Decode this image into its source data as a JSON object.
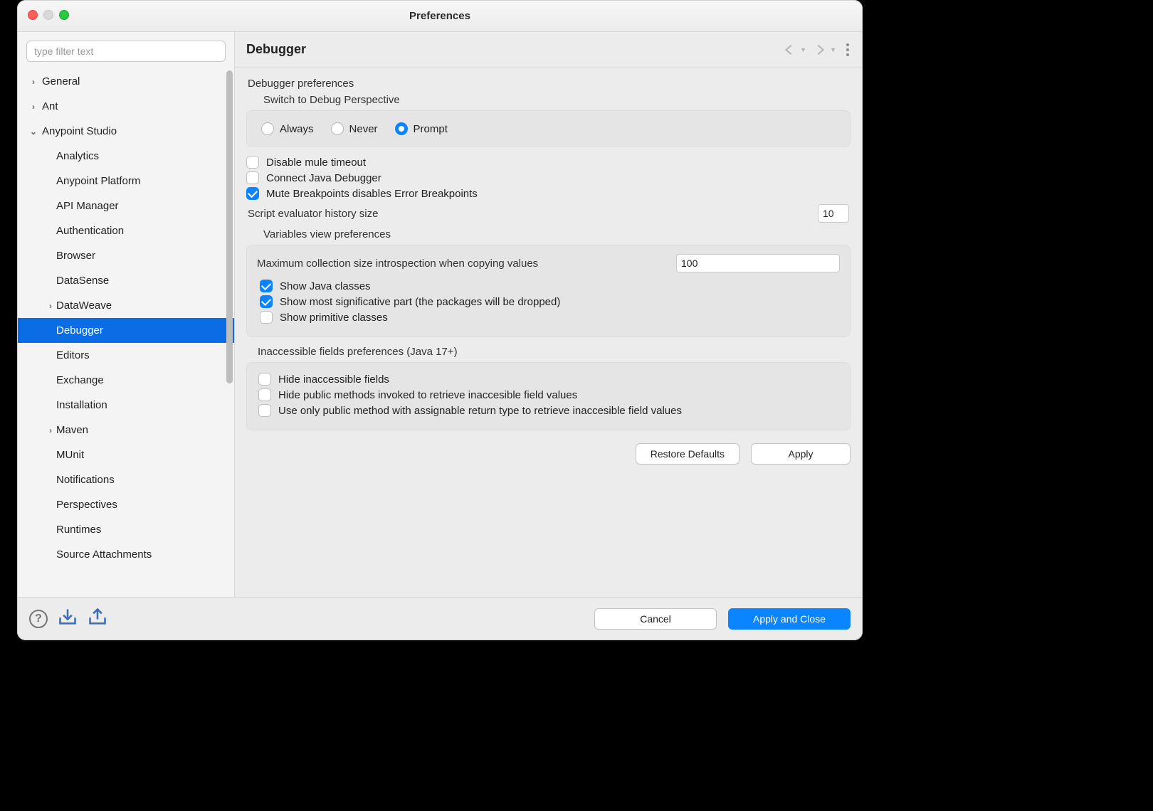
{
  "window": {
    "title": "Preferences"
  },
  "sidebar": {
    "filter_placeholder": "type filter text",
    "items": [
      {
        "label": "General",
        "level": 1,
        "arrow": "right"
      },
      {
        "label": "Ant",
        "level": 1,
        "arrow": "right"
      },
      {
        "label": "Anypoint Studio",
        "level": 1,
        "arrow": "down"
      },
      {
        "label": "Analytics",
        "level": 2
      },
      {
        "label": "Anypoint Platform",
        "level": 2
      },
      {
        "label": "API Manager",
        "level": 2
      },
      {
        "label": "Authentication",
        "level": 2
      },
      {
        "label": "Browser",
        "level": 2
      },
      {
        "label": "DataSense",
        "level": 2
      },
      {
        "label": "DataWeave",
        "level": 2,
        "arrow": "right"
      },
      {
        "label": "Debugger",
        "level": 2,
        "selected": true
      },
      {
        "label": "Editors",
        "level": 2
      },
      {
        "label": "Exchange",
        "level": 2
      },
      {
        "label": "Installation",
        "level": 2
      },
      {
        "label": "Maven",
        "level": 2,
        "arrow": "right"
      },
      {
        "label": "MUnit",
        "level": 2
      },
      {
        "label": "Notifications",
        "level": 2
      },
      {
        "label": "Perspectives",
        "level": 2
      },
      {
        "label": "Runtimes",
        "level": 2
      },
      {
        "label": "Source Attachments",
        "level": 2
      }
    ]
  },
  "content": {
    "heading": "Debugger",
    "group_label": "Debugger preferences",
    "switch_label": "Switch to Debug Perspective",
    "radios": {
      "always": "Always",
      "never": "Never",
      "prompt": "Prompt",
      "selected": "prompt"
    },
    "disable_mule_timeout": {
      "label": "Disable mule timeout",
      "checked": false
    },
    "connect_java_debugger": {
      "label": "Connect Java Debugger",
      "checked": false
    },
    "mute_breakpoints": {
      "label": "Mute Breakpoints disables Error Breakpoints",
      "checked": true
    },
    "history_size": {
      "label": "Script evaluator history size",
      "value": "10"
    },
    "vars_label": "Variables view preferences",
    "max_collection": {
      "label": "Maximum collection size introspection when copying values",
      "value": "100"
    },
    "show_java": {
      "label": "Show Java classes",
      "checked": true
    },
    "show_significative": {
      "label": "Show most significative part (the packages will be dropped)",
      "checked": true
    },
    "show_primitive": {
      "label": "Show primitive classes",
      "checked": false
    },
    "inaccessible_label": "Inaccessible fields preferences (Java 17+)",
    "hide_inaccessible": {
      "label": "Hide inaccessible fields",
      "checked": false
    },
    "hide_public_methods": {
      "label": "Hide public methods invoked to retrieve inaccesible field values",
      "checked": false
    },
    "use_only_public": {
      "label": "Use only public method with assignable return type to retrieve inaccesible field values",
      "checked": false
    },
    "restore_defaults": "Restore Defaults",
    "apply": "Apply"
  },
  "footer": {
    "cancel": "Cancel",
    "apply_close": "Apply and Close"
  }
}
